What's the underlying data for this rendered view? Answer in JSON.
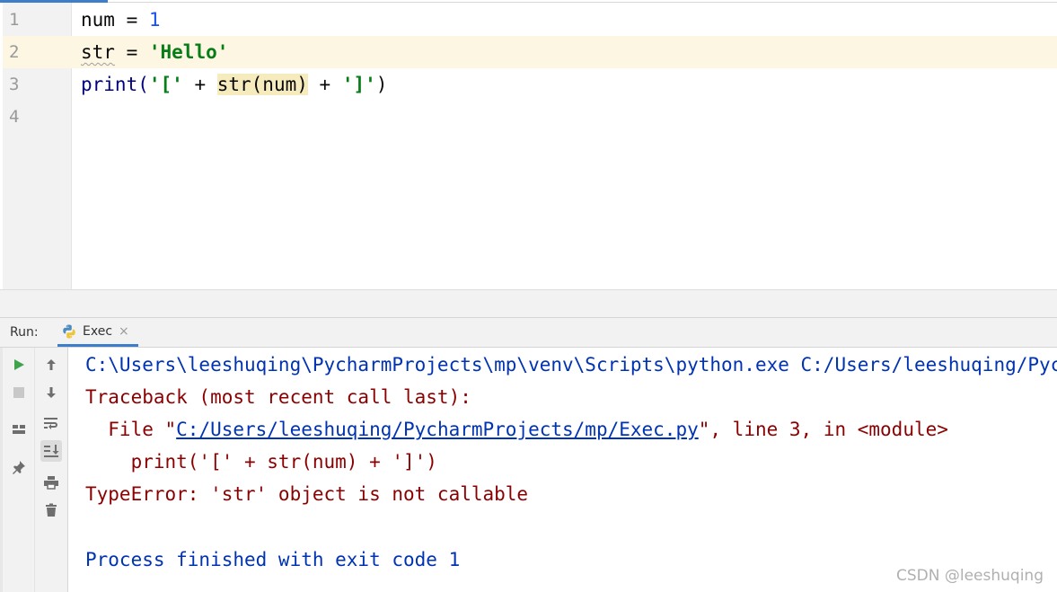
{
  "editor": {
    "line_numbers": [
      "1",
      "2",
      "3",
      "4"
    ],
    "lines": {
      "l1": {
        "a": "num = ",
        "b": "1"
      },
      "l2": {
        "a": "str",
        "b": " = ",
        "c": "'Hello'"
      },
      "l3": {
        "a": "print(",
        "b": "'['",
        "c": " + ",
        "d": "str(num)",
        "e": " + ",
        "f": "']'",
        "g": ")"
      }
    }
  },
  "run_panel": {
    "label": "Run:",
    "tab_label": "Exec",
    "tab_close": "×"
  },
  "console": {
    "line1": "C:\\Users\\leeshuqing\\PycharmProjects\\mp\\venv\\Scripts\\python.exe C:/Users/leeshuqing/PycharmProjects/mp/Exec.py",
    "line2": "Traceback (most recent call last):",
    "line3_pre": "  File \"",
    "line3_link": "C:/Users/leeshuqing/PycharmProjects/mp/Exec.py",
    "line3_post": "\", line 3, in <module>",
    "line4": "    print('[' + str(num) + ']')",
    "line5": "TypeError: 'str' object is not callable",
    "line7": "Process finished with exit code 1"
  },
  "watermark": "CSDN @leeshuqing",
  "colors": {
    "accent": "#3d7dc9",
    "error_text": "#8b0000",
    "console_blue": "#0033b3",
    "string_green": "#067d17",
    "number_blue": "#1750eb"
  },
  "icons": {
    "toolbar_col1": [
      "run-icon",
      "stop-icon",
      "layout-icon",
      "pin-icon"
    ],
    "toolbar_col2": [
      "up-arrow-icon",
      "down-arrow-icon",
      "soft-wrap-icon",
      "scroll-to-end-icon",
      "print-icon",
      "trash-icon"
    ]
  }
}
